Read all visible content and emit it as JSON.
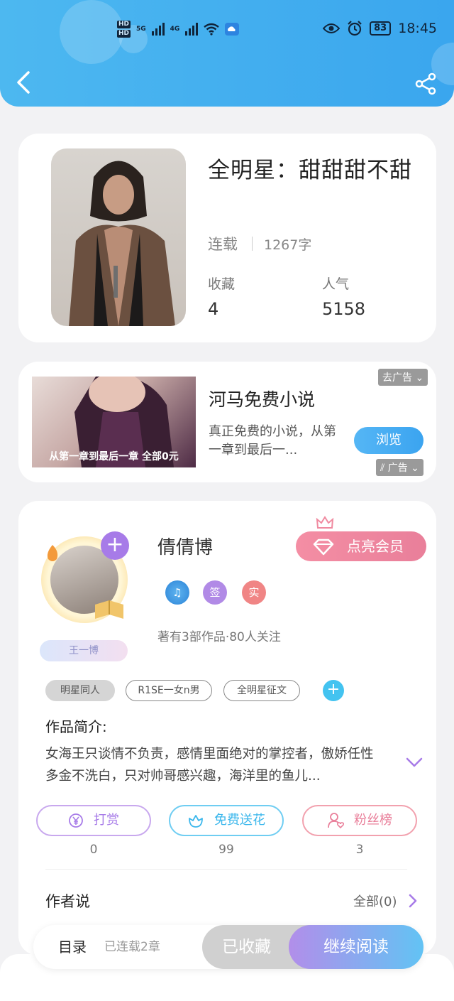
{
  "status_bar": {
    "hd1": "HD",
    "hd2": "HD",
    "net1": "5G",
    "net2": "4G",
    "battery": "83",
    "time": "18:45"
  },
  "book": {
    "title": "全明星：甜甜甜不甜",
    "status": "连载",
    "word_count": "1267字",
    "favorites_label": "收藏",
    "favorites_value": "4",
    "popularity_label": "人气",
    "popularity_value": "5158"
  },
  "ad": {
    "image_caption": "从第一章到最后一章 全部0元",
    "title": "河马免费小说",
    "description": "真正免费的小说，从第一章到最后一...",
    "button": "浏览",
    "remove_ad": "去广告",
    "ad_label": "广告"
  },
  "author": {
    "badge_name": "王一博",
    "name": "倩倩博",
    "vip_button": "点亮会员",
    "badge_sign": "签",
    "badge_real": "实",
    "stats": "著有3部作品·80人关注",
    "tags": [
      "明星同人",
      "R1SE一女n男",
      "全明星征文"
    ]
  },
  "intro": {
    "heading": "作品简介:",
    "text": "女海王只谈情不负责，感情里面绝对的掌控者，傲娇任性多金不洗白，只对帅哥感兴趣，海洋里的鱼儿..."
  },
  "actions": [
    {
      "label": "打赏",
      "count": "0"
    },
    {
      "label": "免费送花",
      "count": "99"
    },
    {
      "label": "粉丝榜",
      "count": "3"
    }
  ],
  "author_says": {
    "heading": "作者说",
    "all": "全部(0)"
  },
  "bottom_bar": {
    "toc": "目录",
    "toc_status": "已连载2章",
    "collected": "已收藏",
    "continue": "继续阅读"
  },
  "colors": {
    "header": "#3aa6ee",
    "purple": "#a77be8",
    "pink": "#e97f9a",
    "cyan": "#43c3f0"
  }
}
